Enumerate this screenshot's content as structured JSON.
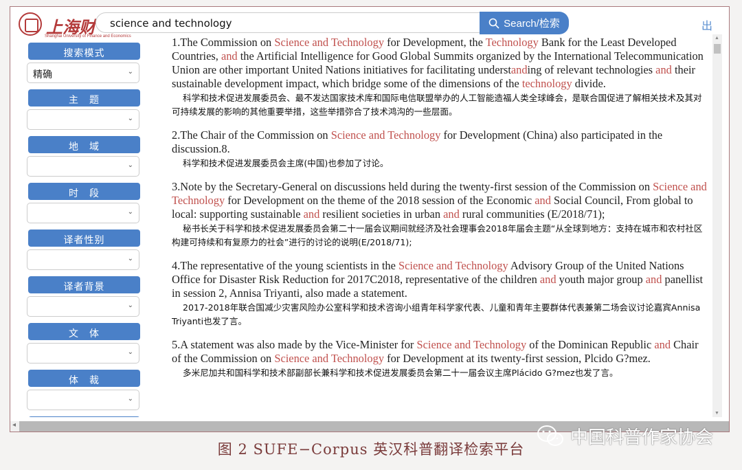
{
  "header": {
    "logo_text": "上海财",
    "logo_subtitle": "Shanghai University of Finance and Economics",
    "search_value": "science and technology",
    "search_button_label": "Search/检索",
    "exit_label": "出"
  },
  "sidebar": {
    "filters": [
      {
        "label": "搜索模式",
        "value": "精确"
      },
      {
        "label": "主　题",
        "value": ""
      },
      {
        "label": "地　域",
        "value": ""
      },
      {
        "label": "时　段",
        "value": ""
      },
      {
        "label": "译者性别",
        "value": ""
      },
      {
        "label": "译者背景",
        "value": ""
      },
      {
        "label": "文　体",
        "value": ""
      },
      {
        "label": "体　裁",
        "value": ""
      },
      {
        "label": "",
        "value": ""
      }
    ]
  },
  "results": [
    {
      "en_parts": [
        {
          "t": "1.The Commission on "
        },
        {
          "t": "Science and Technology",
          "h": true
        },
        {
          "t": " for Development, the "
        },
        {
          "t": "Technology",
          "h": true
        },
        {
          "t": " Bank for the Least Developed Countries, "
        },
        {
          "t": "and",
          "h": true
        },
        {
          "t": " the Artificial Intelligence for Good Global Summits organized by the International Telecommunication Union are other important United Nations initiatives for facilitating underst"
        },
        {
          "t": "and",
          "h": true
        },
        {
          "t": "ing of relevant technologies "
        },
        {
          "t": "and",
          "h": true
        },
        {
          "t": " their sustainable development impact, which bridge some of the dimensions of the "
        },
        {
          "t": "technology",
          "h": true
        },
        {
          "t": " divide."
        }
      ],
      "zh": "科学和技术促进发展委员会、最不发达国家技术库和国际电信联盟举办的人工智能造福人类全球峰会，是联合国促进了解相关技术及其对可持续发展的影响的其他重要举措，这些举措弥合了技术鸿沟的一些层面。"
    },
    {
      "en_parts": [
        {
          "t": "2.The Chair of the Commission on "
        },
        {
          "t": "Science and Technology",
          "h": true
        },
        {
          "t": " for Development (China) also participated in the discussion.8."
        }
      ],
      "zh": "科学和技术促进发展委员会主席(中国)也参加了讨论。"
    },
    {
      "en_parts": [
        {
          "t": "3.Note by the Secretary-General on discussions held during the twenty-first session of the Commission on "
        },
        {
          "t": "Science and Technology",
          "h": true
        },
        {
          "t": " for Development on the theme of the 2018 session of the Economic "
        },
        {
          "t": "and",
          "h": true
        },
        {
          "t": " Social Council, From global to local: supporting sustainable "
        },
        {
          "t": "and",
          "h": true
        },
        {
          "t": " resilient societies in urban "
        },
        {
          "t": "and",
          "h": true
        },
        {
          "t": " rural communities (E/2018/71);"
        }
      ],
      "zh": "秘书长关于科学和技术促进发展委员会第二十一届会议期间就经济及社会理事会2018年届会主题“从全球到地方：支持在城市和农村社区构建可持续和有复原力的社会”进行的讨论的说明(E/2018/71);"
    },
    {
      "en_parts": [
        {
          "t": "4.The representative of the young scientists in the "
        },
        {
          "t": "Science and Technology",
          "h": true
        },
        {
          "t": " Advisory Group of the United Nations Office for Disaster Risk Reduction for 2017C2018, representative of the children "
        },
        {
          "t": "and",
          "h": true
        },
        {
          "t": " youth major group "
        },
        {
          "t": "and",
          "h": true
        },
        {
          "t": " panellist in session 2, Annisa Triyanti, also made a statement."
        }
      ],
      "zh": "2017-2018年联合国减少灾害风险办公室科学和技术咨询小组青年科学家代表、儿童和青年主要群体代表兼第二场会议讨论嘉宾Annisa Triyanti也发了言。"
    },
    {
      "en_parts": [
        {
          "t": "5.A statement was also made by the Vice-Minister for "
        },
        {
          "t": "Science and Technology",
          "h": true
        },
        {
          "t": " of the Dominican Republic "
        },
        {
          "t": "and",
          "h": true
        },
        {
          "t": " Chair of the Commission on "
        },
        {
          "t": "Science and Technology",
          "h": true
        },
        {
          "t": " for Development at its twenty-first session, Plcido G?mez."
        }
      ],
      "zh": "多米尼加共和国科学和技术部副部长兼科学和技术促进发展委员会第二十一届会议主席Plácido G?mez也发了言。"
    }
  ],
  "caption": "图 2 SUFE−Corpus 英汉科普翻译检索平台",
  "watermark": "中国科普作家协会",
  "colors": {
    "accent": "#4a80c8",
    "highlight": "#c0504d",
    "caption": "#7a3b3b"
  }
}
